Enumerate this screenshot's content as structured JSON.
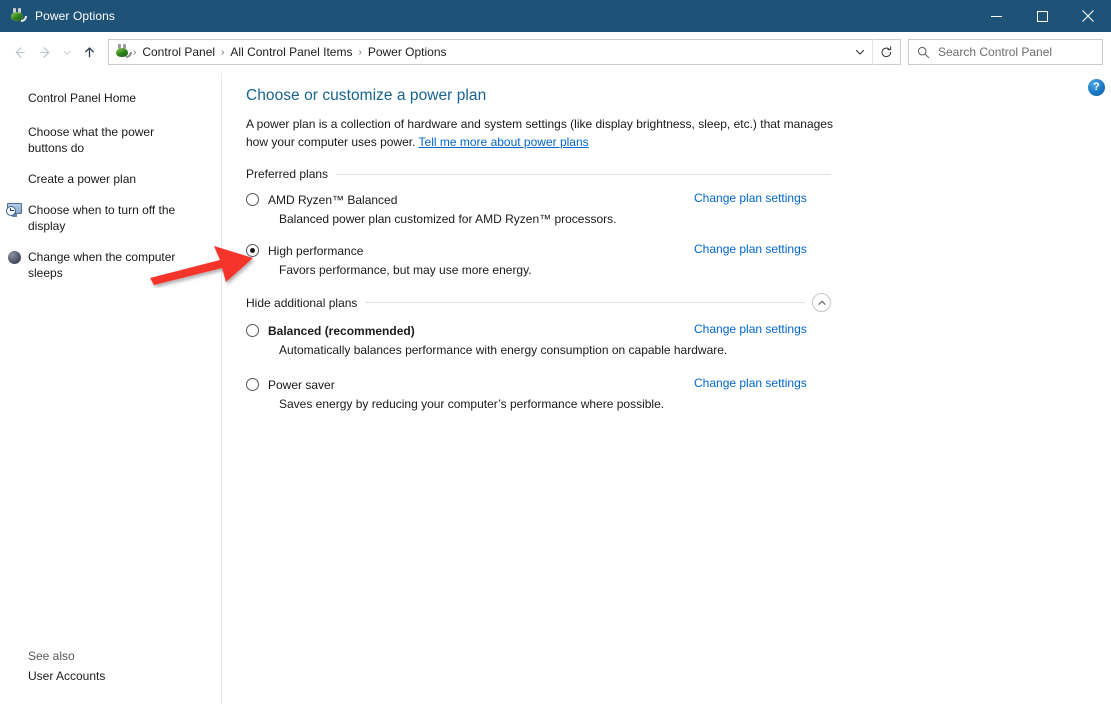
{
  "window": {
    "title": "Power Options",
    "icon": "power-plug-icon",
    "minimize_label": "Minimize",
    "maximize_label": "Maximize",
    "close_label": "Close"
  },
  "navbar": {
    "back_label": "Back",
    "forward_label": "Forward",
    "recent_label": "Recent locations",
    "up_label": "Up",
    "refresh_label": "Refresh",
    "dropdown_label": "Previous locations",
    "breadcrumbs": [
      "Control Panel",
      "All Control Panel Items",
      "Power Options"
    ],
    "separator": "›"
  },
  "search": {
    "placeholder": "Search Control Panel",
    "value": "",
    "icon": "search-icon"
  },
  "help": {
    "label": "?"
  },
  "sidebar": {
    "home_label": "Control Panel Home",
    "items": [
      {
        "label": "Choose what the power buttons do",
        "icon": null
      },
      {
        "label": "Create a power plan",
        "icon": null
      },
      {
        "label": "Choose when to turn off the display",
        "icon": "display-clock-icon"
      },
      {
        "label": "Change when the computer sleeps",
        "icon": "moon-sleep-icon"
      }
    ],
    "see_also_title": "See also",
    "see_also_links": [
      "User Accounts"
    ]
  },
  "main": {
    "page_title": "Choose or customize a power plan",
    "description_part1": "A power plan is a collection of hardware and system settings (like display brightness, sleep, etc.) that manages how your computer uses power. ",
    "description_link": "Tell me more about power plans",
    "preferred_group_label": "Preferred plans",
    "additional_group_label": "Hide additional plans",
    "collapse_icon": "chevron-up-icon",
    "change_link_label": "Change plan settings",
    "preferred_plans": [
      {
        "name": "AMD Ryzen™ Balanced",
        "description": "Balanced power plan customized for AMD Ryzen™ processors.",
        "selected": false,
        "bold": false
      },
      {
        "name": "High performance",
        "description": "Favors performance, but may use more energy.",
        "selected": true,
        "bold": false
      }
    ],
    "additional_plans": [
      {
        "name": "Balanced (recommended)",
        "description": "Automatically balances performance with energy consumption on capable hardware.",
        "selected": false,
        "bold": true
      },
      {
        "name": "Power saver",
        "description": "Saves energy by reducing your computer’s performance where possible.",
        "selected": false,
        "bold": false
      }
    ]
  },
  "annotation": {
    "arrow_color": "#f5342c",
    "arrow_target": "High performance radio button"
  },
  "colors": {
    "titlebar": "#1f5277",
    "link": "#0066cc",
    "heading": "#18638f",
    "text": "#1a1a1a",
    "help_blue": "#1979c4"
  }
}
